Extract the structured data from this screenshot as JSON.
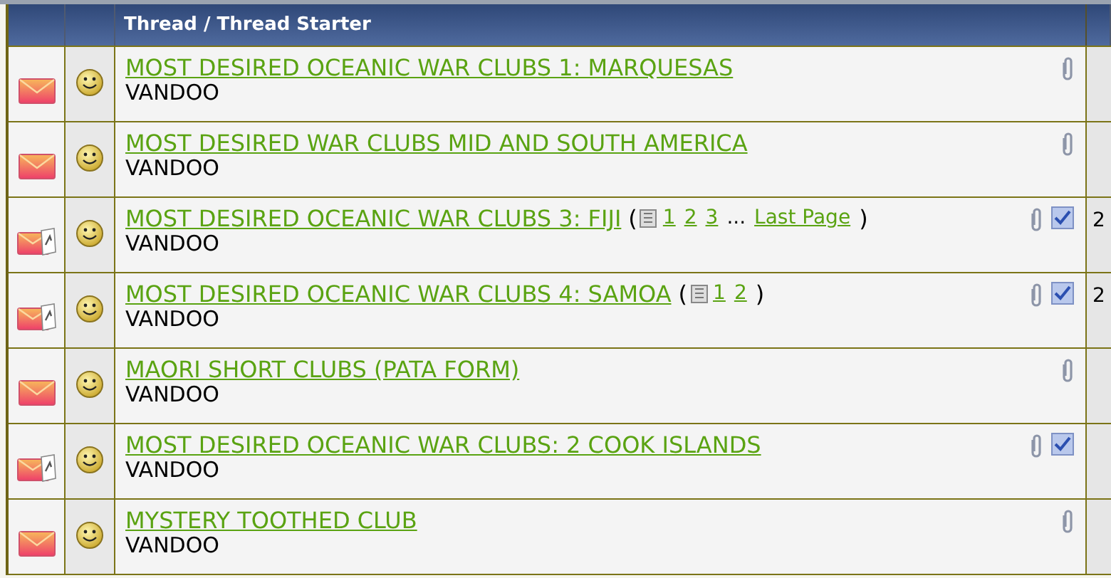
{
  "table": {
    "columns": [
      "Thread / Thread Starter"
    ],
    "rows": [
      {
        "title": "MOST DESIRED OCEANIC WAR CLUBS 1: MARQUESAS",
        "starter": "VANDOO",
        "hot": false,
        "attachment": true,
        "posted": false
      },
      {
        "title": "MOST DESIRED WAR CLUBS MID AND SOUTH AMERICA",
        "starter": "VANDOO",
        "hot": false,
        "attachment": true,
        "posted": false
      },
      {
        "title": "MOST DESIRED OCEANIC WAR CLUBS 3: FIJI",
        "starter": "VANDOO",
        "hot": true,
        "attachment": true,
        "posted": true,
        "page_nav": {
          "open": "(",
          "pages": [
            "1",
            "2",
            "3"
          ],
          "ellipsis": "...",
          "last": "Last Page",
          "close": ")"
        },
        "column_3": "2"
      },
      {
        "title": "MOST DESIRED OCEANIC WAR CLUBS 4: SAMOA",
        "starter": "VANDOO",
        "hot": true,
        "attachment": true,
        "posted": true,
        "page_nav": {
          "open": "(",
          "pages": [
            "1",
            "2"
          ],
          "close": ")"
        },
        "column_3": "2"
      },
      {
        "title": "MAORI SHORT CLUBS (PATA FORM)",
        "starter": "VANDOO",
        "hot": false,
        "attachment": true,
        "posted": false
      },
      {
        "title": "MOST DESIRED OCEANIC WAR CLUBS: 2 COOK ISLANDS",
        "starter": "VANDOO",
        "hot": true,
        "attachment": true,
        "posted": true
      },
      {
        "title": "MYSTERY TOOTHED CLUB",
        "starter": "VANDOO",
        "hot": false,
        "attachment": true,
        "posted": false
      }
    ]
  }
}
